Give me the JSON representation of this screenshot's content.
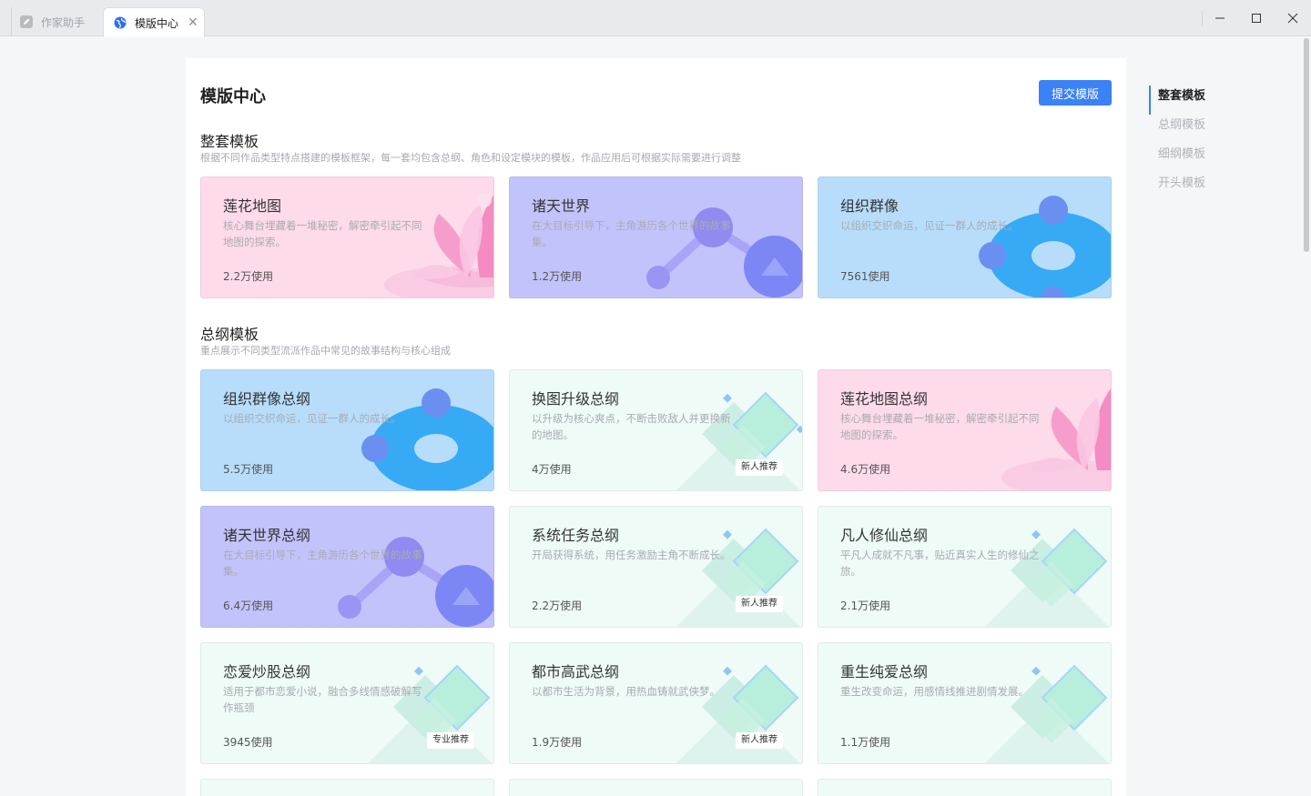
{
  "tabs": [
    {
      "label": "作家助手",
      "icon": "pen-icon",
      "active": false
    },
    {
      "label": "模版中心",
      "icon": "globe-icon",
      "active": true
    }
  ],
  "page": {
    "title": "模版中心",
    "submit_label": "提交模版"
  },
  "sections": {
    "full": {
      "title": "整套模板",
      "desc": "根据不同作品类型特点搭建的模板框架，每一套均包含总纲、角色和设定模块的模板，作品应用后可根据实际需要进行调整"
    },
    "outline": {
      "title": "总纲模板",
      "desc": "重点展示不同类型流派作品中常见的故事结构与核心组成"
    }
  },
  "full_cards": [
    {
      "title": "莲花地图",
      "desc": "核心舞台埋藏着一堆秘密，解密牵引起不同地图的探索。",
      "usage": "2.2万使用",
      "theme": "pink",
      "deco": "lotus-illustration"
    },
    {
      "title": "诸天世界",
      "desc": "在大目标引导下，主角游历各个世界的故事集。",
      "usage": "1.2万使用",
      "theme": "purple",
      "deco": "planets-illustration"
    },
    {
      "title": "组织群像",
      "desc": "以组织交织命运，见证一群人的成长。",
      "usage": "7561使用",
      "theme": "blue",
      "deco": "ring-illustration"
    }
  ],
  "outline_cards": [
    {
      "title": "组织群像总纲",
      "desc": "以组织交织命运，见证一群人的成长。",
      "usage": "5.5万使用",
      "badge": "",
      "theme": "blue"
    },
    {
      "title": "换图升级总纲",
      "desc": "以升级为核心爽点，不断击败敌人并更换新的地图。",
      "usage": "4万使用",
      "badge": "新人推荐",
      "theme": "mint"
    },
    {
      "title": "莲花地图总纲",
      "desc": "核心舞台埋藏着一堆秘密，解密牵引起不同地图的探索。",
      "usage": "4.6万使用",
      "badge": "",
      "theme": "pink"
    },
    {
      "title": "诸天世界总纲",
      "desc": "在大目标引导下，主角游历各个世界的故事集。",
      "usage": "6.4万使用",
      "badge": "",
      "theme": "purple"
    },
    {
      "title": "系统任务总纲",
      "desc": "开局获得系统，用任务激励主角不断成长。",
      "usage": "2.2万使用",
      "badge": "新人推荐",
      "theme": "mint"
    },
    {
      "title": "凡人修仙总纲",
      "desc": "平凡人成就不凡事，贴近真实人生的修仙之旅。",
      "usage": "2.1万使用",
      "badge": "",
      "theme": "mint"
    },
    {
      "title": "恋爱炒股总纲",
      "desc": "适用于都市恋爱小说，融合多线情感破解写作瓶颈",
      "usage": "3945使用",
      "badge": "专业推荐",
      "theme": "mint"
    },
    {
      "title": "都市高武总纲",
      "desc": "以都市生活为背景，用热血铸就武侠梦。",
      "usage": "1.9万使用",
      "badge": "新人推荐",
      "theme": "mint"
    },
    {
      "title": "重生纯爱总纲",
      "desc": "重生改变命运，用感情线推进剧情发展。",
      "usage": "1.1万使用",
      "badge": "",
      "theme": "mint"
    }
  ],
  "right_nav": [
    {
      "label": "整套模板",
      "active": true
    },
    {
      "label": "总纲模板",
      "active": false
    },
    {
      "label": "细纲模板",
      "active": false
    },
    {
      "label": "开头模板",
      "active": false
    }
  ],
  "colors": {
    "accent": "#3a82f5",
    "pink": "#fddbea",
    "purple": "#c3c3fb",
    "blue": "#b7ddfb",
    "mint": "#eefbf6"
  }
}
